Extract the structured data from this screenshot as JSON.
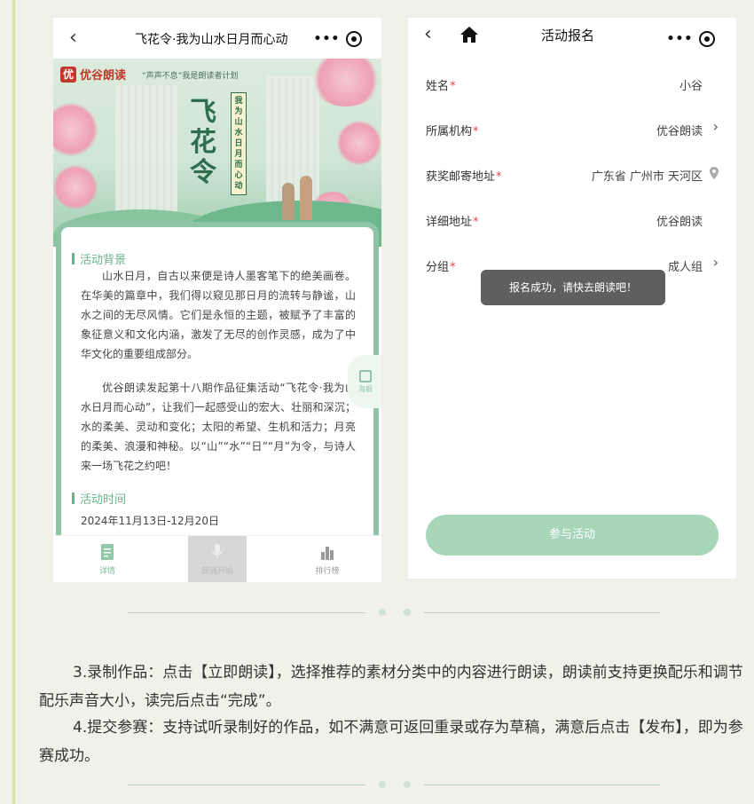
{
  "phone1": {
    "title": "飞花令·我为山水日月而心动",
    "brand": "优谷朗读",
    "slogan": "“声声不息”我是朗读者计划",
    "calligraphy_title": "飞花令",
    "banner_subtitle": "我为山水日月而心动",
    "section1_title": "活动背景",
    "paragraph1": "山水日月，自古以来便是诗人墨客笔下的绝美画卷。在华美的篇章中，我们得以窥见那日月的流转与静谧，山水之间的无尽风情。它们是永恒的主题，被赋予了丰富的象征意义和文化内涵，激发了无尽的创作灵感，成为了中华文化的重要组成部分。",
    "paragraph2": "优谷朗读发起第十八期作品征集活动“飞花令·我为山水日月而心动”，让我们一起感受山的宏大、壮丽和深沉；水的柔美、灵动和变化；太阳的希望、生机和活力；月亮的柔美、浪漫和神秘。以“山”“水”“日”“月”为令，与诗人来一场飞花之约吧！",
    "section2_title": "活动时间",
    "date_range": "2024年11月13日-12月20日",
    "poster_label": "海报",
    "tabs": [
      {
        "label": "详情"
      },
      {
        "label": "朗诵开始"
      },
      {
        "label": "排行榜"
      }
    ]
  },
  "phone2": {
    "title": "活动报名",
    "fields": [
      {
        "label": "姓名",
        "value": "小谷"
      },
      {
        "label": "所属机构",
        "value": "优谷朗读"
      },
      {
        "label": "获奖邮寄地址",
        "value": "广东省 广州市 天河区"
      },
      {
        "label": "详细地址",
        "value": "优谷朗读"
      },
      {
        "label": "分组",
        "value": "成人组"
      }
    ],
    "required_mark": "*",
    "toast": "报名成功，请快去朗读吧！",
    "join_button": "参与活动"
  },
  "instructions": {
    "step3": "3.录制作品：点击【立即朗读】，选择推荐的素材分类中的内容进行朗读，朗读前支持更换配乐和调节配乐声音大小，读完后点击“完成”。",
    "step4": "4.提交参赛：支持试听录制好的作品，如不满意可返回重录或存为草稿，满意后点击【发布】，即为参赛成功。"
  },
  "colors": {
    "accent_green": "#6bb38b",
    "button_green": "#a7d6b9",
    "required_red": "#e04b4b",
    "page_bg": "#f2f1e9"
  }
}
